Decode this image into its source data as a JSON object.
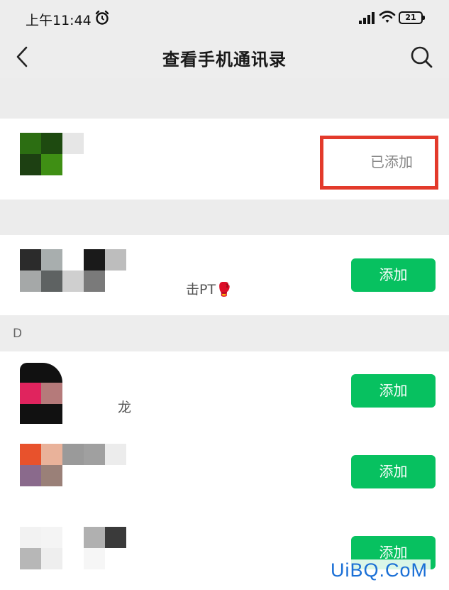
{
  "status_bar": {
    "time": "上午11:44",
    "battery_level": "21"
  },
  "nav": {
    "title": "查看手机通讯录"
  },
  "contacts": [
    {
      "name_fragment": "",
      "action": "已添加"
    },
    {
      "name_fragment": "击PT🥊",
      "action": "添加"
    },
    {
      "name_fragment": "龙",
      "action": "添加"
    },
    {
      "name_fragment": "",
      "action": "添加"
    },
    {
      "name_fragment": "",
      "action": "添加"
    }
  ],
  "section": {
    "letter": "D"
  },
  "watermark": "UiBQ.CoM",
  "colors": {
    "accent_green": "#07c160",
    "highlight_red": "#e33a2b",
    "background": "#ededed"
  }
}
